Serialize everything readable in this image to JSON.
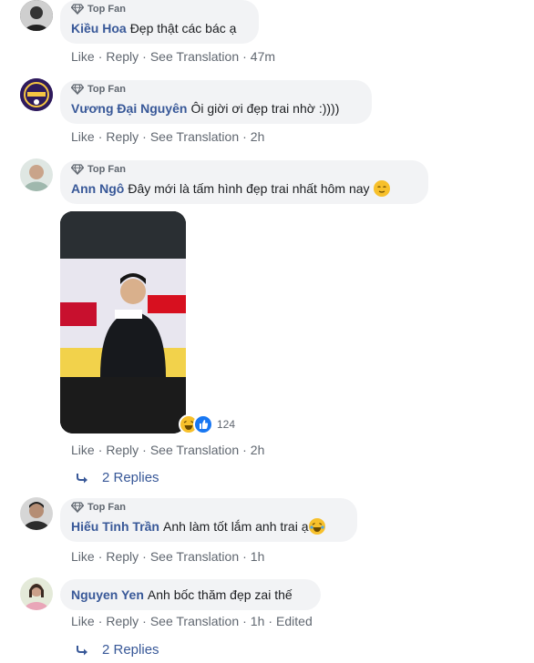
{
  "colors": {
    "link": "#385898",
    "meta": "#606770",
    "bubble": "#f2f3f5",
    "like_blue": "#1877f2",
    "haha_yellow": "#f7c02b"
  },
  "comments": [
    {
      "badge": "Top Fan",
      "author": "Kiều Hoa",
      "text": "Đẹp thật các bác ạ",
      "actions": {
        "like": "Like",
        "reply": "Reply",
        "translate": "See Translation",
        "time": "47m"
      }
    },
    {
      "badge": "Top Fan",
      "author": "Vương Đại Nguyên",
      "text": "Ôi giời ơi đẹp trai nhờ :))))",
      "actions": {
        "like": "Like",
        "reply": "Reply",
        "translate": "See Translation",
        "time": "2h"
      }
    },
    {
      "badge": "Top Fan",
      "author": "Ann Ngô",
      "text": "Đây mới là tấm hình đẹp trai nhất hôm nay",
      "emoji": "relieved-face",
      "actions": {
        "like": "Like",
        "reply": "Reply",
        "translate": "See Translation",
        "time": "2h"
      },
      "reaction_count": "124",
      "reaction_icons": [
        "haha-icon",
        "like-icon"
      ],
      "replies": "2 Replies"
    },
    {
      "badge": "Top Fan",
      "author": "Hiếu Tinh Trần",
      "text": "Anh làm tốt lắm anh trai ạ",
      "emoji": "laughing-face",
      "actions": {
        "like": "Like",
        "reply": "Reply",
        "translate": "See Translation",
        "time": "1h"
      }
    },
    {
      "author": "Nguyen Yen",
      "text": "Anh bốc thăm đẹp zai thế",
      "actions": {
        "like": "Like",
        "reply": "Reply",
        "translate": "See Translation",
        "time": "1h",
        "edited": "Edited"
      },
      "replies": "2 Replies"
    }
  ]
}
